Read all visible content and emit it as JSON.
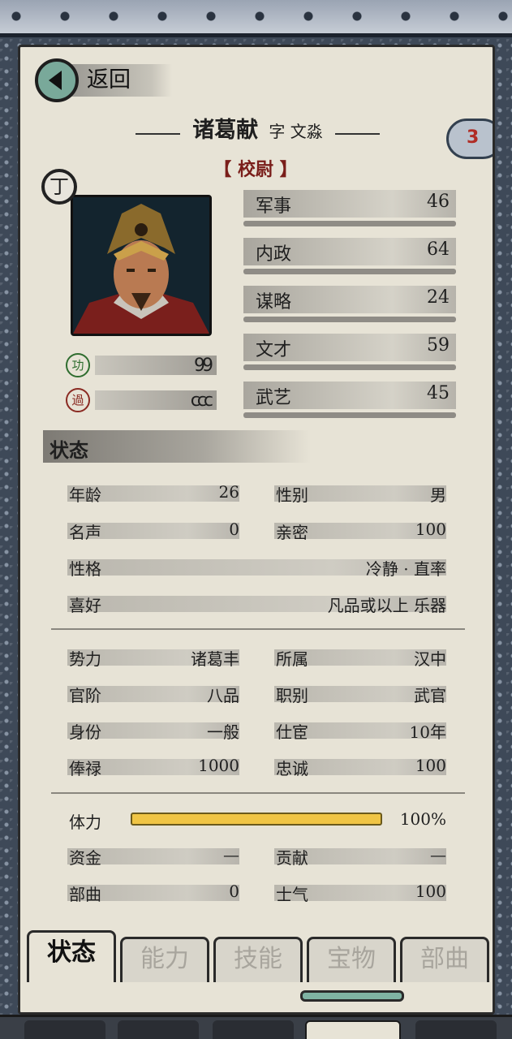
{
  "header": {
    "back_label": "返回",
    "name": "诸葛献",
    "zi_label": "字 文淼",
    "rank": "【 校尉 】",
    "cloud_count": "3",
    "grade": "丁"
  },
  "merit": {
    "gong_label": "功",
    "gong_value": "99",
    "guo_label": "過",
    "guo_value": "ccc"
  },
  "attributes": [
    {
      "label": "军事",
      "value": "46"
    },
    {
      "label": "内政",
      "value": "64"
    },
    {
      "label": "谋略",
      "value": "24"
    },
    {
      "label": "文才",
      "value": "59"
    },
    {
      "label": "武艺",
      "value": "45"
    }
  ],
  "status": {
    "title": "状态",
    "age_label": "年龄",
    "age": "26",
    "gender_label": "性别",
    "gender": "男",
    "fame_label": "名声",
    "fame": "0",
    "intimacy_label": "亲密",
    "intimacy": "100",
    "personality_label": "性格",
    "personality": "冷静 · 直率",
    "hobby_label": "喜好",
    "hobby": "凡品或以上 乐器",
    "faction_label": "势力",
    "faction": "诸葛丰",
    "belong_label": "所属",
    "belong": "汉中",
    "rank_label": "官阶",
    "rank_value": "八品",
    "post_label": "职别",
    "post": "武官",
    "identity_label": "身份",
    "identity": "一般",
    "service_label": "仕宦",
    "service": "10年",
    "salary_label": "俸禄",
    "salary": "1000",
    "loyalty_label": "忠诚",
    "loyalty": "100",
    "stamina_label": "体力",
    "stamina": "100%",
    "stamina_fraction": 1.0,
    "funds_label": "资金",
    "funds": "—",
    "contrib_label": "贡献",
    "contrib": "—",
    "troops_label": "部曲",
    "troops": "0",
    "morale_label": "士气",
    "morale": "100"
  },
  "tabs": [
    "状态",
    "能力",
    "技能",
    "宝物",
    "部曲"
  ],
  "colors": {
    "stamina": "#f0c545",
    "paper": "#e7e3d6",
    "rank": "#7a1e1a"
  }
}
